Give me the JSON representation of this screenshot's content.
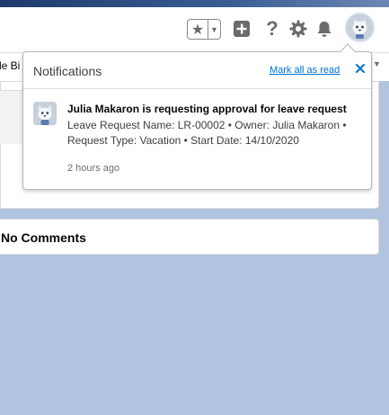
{
  "header": {
    "favorites_icon": "star-icon",
    "favorites_menu_icon": "caret-down-icon",
    "add_icon": "plus-icon",
    "help_glyph": "?",
    "setup_icon": "gear-icon",
    "notifications_icon": "bell-icon",
    "avatar_icon": "astro-avatar-icon"
  },
  "nav": {
    "tab_fragment": "le Bi"
  },
  "comments_card": {
    "title": "No Comments"
  },
  "notifications": {
    "title": "Notifications",
    "mark_all_label": "Mark all as read",
    "close_icon": "close-icon",
    "items": [
      {
        "avatar_icon": "astro-avatar-icon",
        "title": "Julia Makaron is requesting approval for leave request",
        "body": "Leave Request Name: LR-00002 • Owner: Julia Makaron • Request Type: Vacation • Start Date: 14/10/2020",
        "time": "2 hours ago"
      }
    ]
  },
  "colors": {
    "page_background": "#b0c4df",
    "link": "#0070d2",
    "icon_gray": "#6b6b6b"
  }
}
